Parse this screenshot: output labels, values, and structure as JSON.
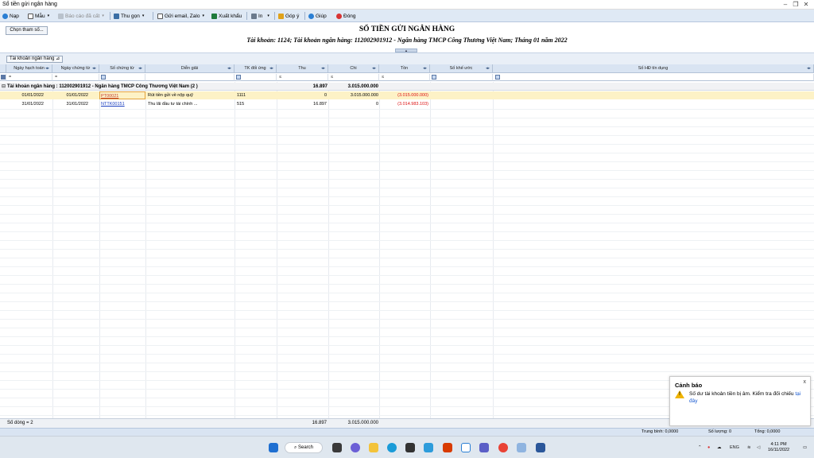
{
  "window": {
    "title": "Sổ tiền gửi ngân hàng"
  },
  "toolbar": {
    "nap": "Nạp",
    "mau": "Mẫu",
    "bao_cao_da_cat": "Báo cáo đã cất",
    "thu_gon": "Thu gọn",
    "gui_email": "Gửi email, Zalo",
    "xuat_khau": "Xuất khẩu",
    "in": "In",
    "gop_y": "Góp ý",
    "giup": "Giúp",
    "dong": "Đóng"
  },
  "report": {
    "chon_tham_so": "Chọn tham số...",
    "title": "SỔ TIỀN GỬI NGÂN HÀNG",
    "subtitle": "Tài khoản: 1124; Tài khoản ngân hàng: 112002901912 - Ngân hàng TMCP Công Thương Việt Nam; Tháng 01 năm 2022"
  },
  "grouping": {
    "chip": "Tài khoản ngân hàng",
    "chip_icon": "sort-up-icon"
  },
  "columns": {
    "ngay_hach_toan": "Ngày hạch toán",
    "ngay_chung_tu": "Ngày chứng từ",
    "so_chung_tu": "Số chứng từ",
    "dien_giai": "Diễn giải",
    "tk_doi_ung": "TK đối ứng",
    "thu": "Thu",
    "chi": "Chi",
    "ton": "Tồn",
    "so_khe_uoc": "Số khế ước",
    "so_hd_tin_dung": "Số HĐ tín dụng"
  },
  "filters": {
    "eq": "=",
    "le": "≤"
  },
  "group_row": {
    "label": "Tài khoản ngân hàng : 112002901912 - Ngân hàng TMCP Công Thương Việt Nam (2 )",
    "thu": "16.897",
    "chi": "3.015.000.000"
  },
  "rows": [
    {
      "ngay_hach_toan": "01/01/2022",
      "ngay_chung_tu": "01/01/2022",
      "so_chung_tu": "PT00021",
      "dien_giai": "Rút tiền gửi về nộp quỹ",
      "tk_doi_ung": "1111",
      "thu": "0",
      "chi": "3.015.000.000",
      "ton": "(3.015.000.000)"
    },
    {
      "ngay_hach_toan": "31/01/2022",
      "ngay_chung_tu": "31/01/2022",
      "so_chung_tu": "NTTK00151",
      "dien_giai": "Thu lãi đầu tư tài chính ...",
      "tk_doi_ung": "515",
      "thu": "16.897",
      "chi": "0",
      "ton": "(3.014.983.103)"
    }
  ],
  "footer": {
    "so_dong": "Số dòng = 2",
    "thu": "16.897",
    "chi": "3.015.000.000"
  },
  "status": {
    "trung_binh": "Trung bình: 0,0000",
    "so_luong": "Số lượng: 0",
    "tong": "Tổng: 0,0000"
  },
  "popup": {
    "title": "Cảnh báo",
    "text": "Số dư tài khoản tiền bị âm. Kiểm tra đối chiếu",
    "link": "tại đây",
    "close": "x"
  },
  "taskbar": {
    "search": "Search",
    "lang": "ENG",
    "time": "4:11 PM",
    "date": "16/11/2022"
  },
  "colors": {
    "toolbar_bg": "#dfe9f5",
    "header_bg": "#d9e4f2",
    "selected_row": "#fdf2c6",
    "negative": "#dd1111",
    "link": "#1a3fbf"
  }
}
